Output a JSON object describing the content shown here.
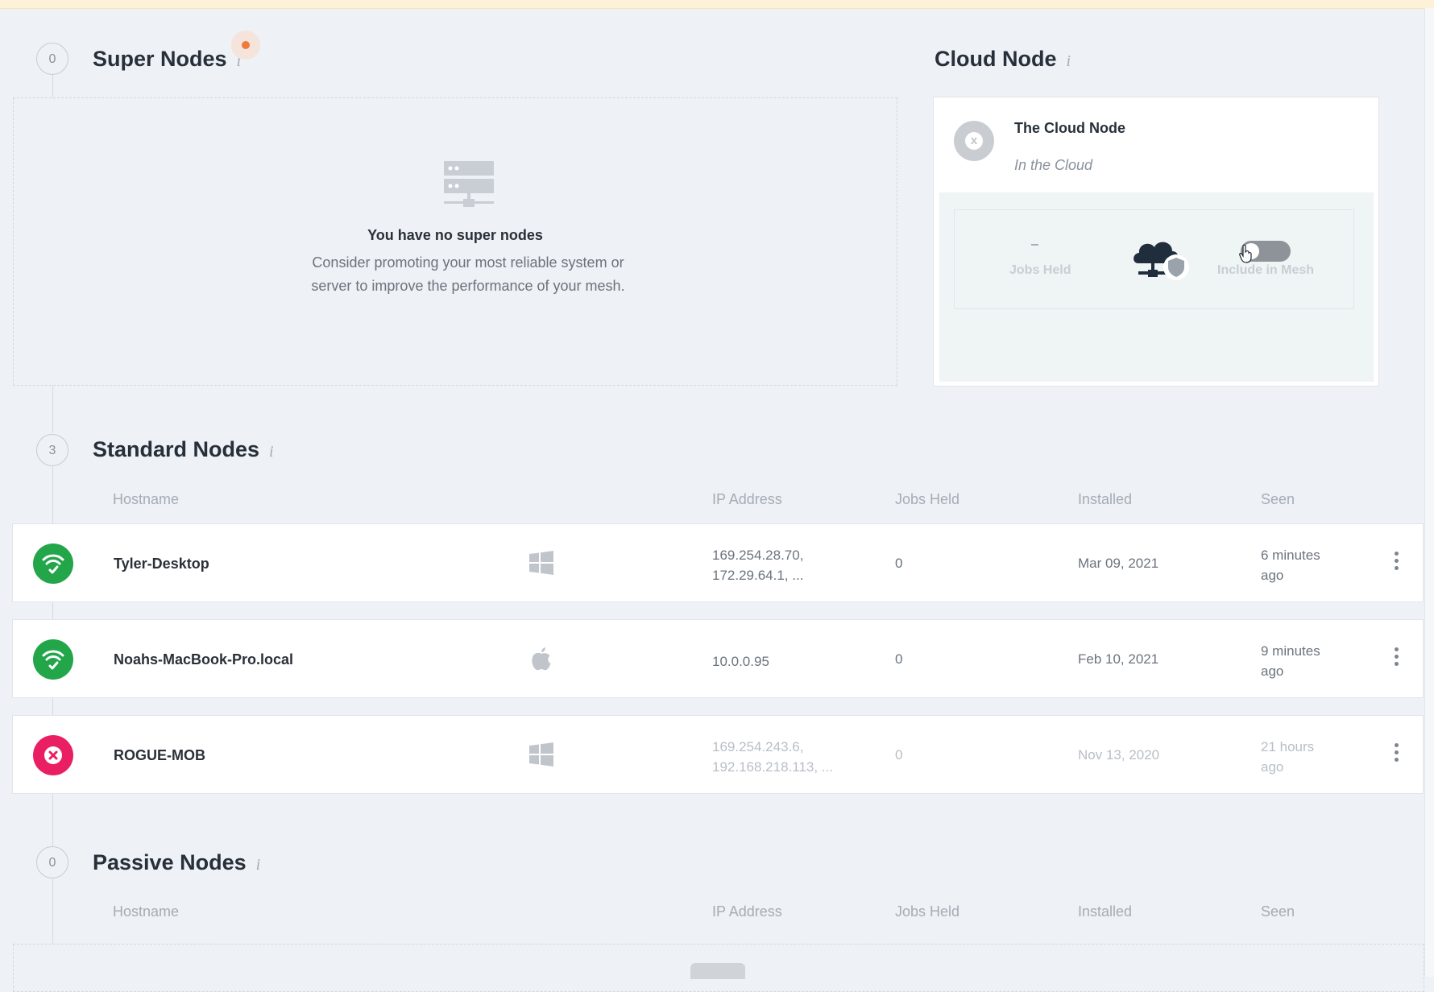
{
  "super_nodes": {
    "count": "0",
    "title": "Super Nodes",
    "info": "i",
    "empty_title": "You have no super nodes",
    "empty_description": "Consider promoting your most reliable system or server to improve the performance of your mesh."
  },
  "cloud_node": {
    "title": "Cloud Node",
    "info": "i",
    "name": "The Cloud Node",
    "location": "In the Cloud",
    "status_icon": "x",
    "jobs_value": "–",
    "jobs_label": "Jobs Held",
    "mesh_label": "Include in Mesh",
    "include_in_mesh": false
  },
  "standard_nodes": {
    "count": "3",
    "title": "Standard Nodes",
    "info": "i",
    "columns": [
      "Hostname",
      "IP Address",
      "Jobs Held",
      "Installed",
      "Seen"
    ],
    "rows": [
      {
        "status": "online",
        "hostname": "Tyler-Desktop",
        "os": "windows-icon",
        "ip1": "169.254.28.70,",
        "ip2": "172.29.64.1, ...",
        "jobs": "0",
        "installed": "Mar 09, 2021",
        "seen1": "6 minutes",
        "seen2": "ago"
      },
      {
        "status": "online",
        "hostname": "Noahs-MacBook-Pro.local",
        "os": "apple-icon",
        "ip1": "10.0.0.95",
        "ip2": "",
        "jobs": "0",
        "installed": "Feb 10, 2021",
        "seen1": "9 minutes",
        "seen2": "ago"
      },
      {
        "status": "offline",
        "hostname": "ROGUE-MOB",
        "os": "windows-icon",
        "ip1": "169.254.243.6,",
        "ip2": "192.168.218.113, ...",
        "jobs": "0",
        "installed": "Nov 13, 2020",
        "seen1": "21 hours",
        "seen2": "ago"
      }
    ]
  },
  "passive_nodes": {
    "count": "0",
    "title": "Passive Nodes",
    "info": "i",
    "columns": [
      "Hostname",
      "IP Address",
      "Jobs Held",
      "Installed",
      "Seen"
    ]
  },
  "colors": {
    "online": "#23a64a",
    "offline": "#ea1f63",
    "notification": "#f07a3a",
    "background": "#eef1f5"
  }
}
